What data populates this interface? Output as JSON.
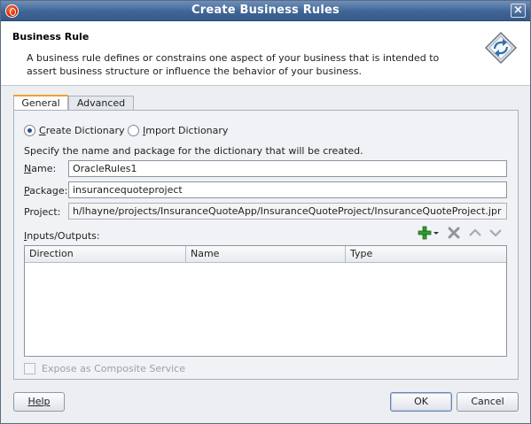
{
  "window": {
    "title": "Create Business Rules"
  },
  "header": {
    "title": "Business Rule",
    "description": "A business rule defines or constrains one aspect of your business that is intended to assert business structure or influence the behavior of your business."
  },
  "tabs": [
    {
      "label": "General",
      "active": true
    },
    {
      "label": "Advanced",
      "active": false
    }
  ],
  "options": {
    "create_dictionary": {
      "label_first": "C",
      "label_rest": "reate Dictionary",
      "checked": true
    },
    "import_dictionary": {
      "label_first": "I",
      "label_rest": "mport Dictionary",
      "checked": false
    }
  },
  "spec_text": "Specify the name and package for the dictionary that will be created.",
  "fields": {
    "name": {
      "label_first": "N",
      "label_rest": "ame:",
      "value": "OracleRules1"
    },
    "package": {
      "label_first": "P",
      "label_rest": "ackage:",
      "value": "insurancequoteproject"
    },
    "project": {
      "label": "Project:",
      "value": "h/lhayne/projects/InsuranceQuoteApp/InsuranceQuoteProject/InsuranceQuoteProject.jpr"
    }
  },
  "io": {
    "label_first": "I",
    "label_rest": "nputs/Outputs:",
    "columns": [
      "Direction",
      "Name",
      "Type"
    ],
    "rows": []
  },
  "composite": {
    "label": "Expose as Composite Service",
    "checked": false,
    "enabled": false
  },
  "buttons": {
    "help": "Help",
    "ok": "OK",
    "cancel": "Cancel"
  },
  "colors": {
    "titlebar": "#3f6596",
    "active_tab_accent": "#f0a22a",
    "add_icon": "#2e9c2e"
  }
}
